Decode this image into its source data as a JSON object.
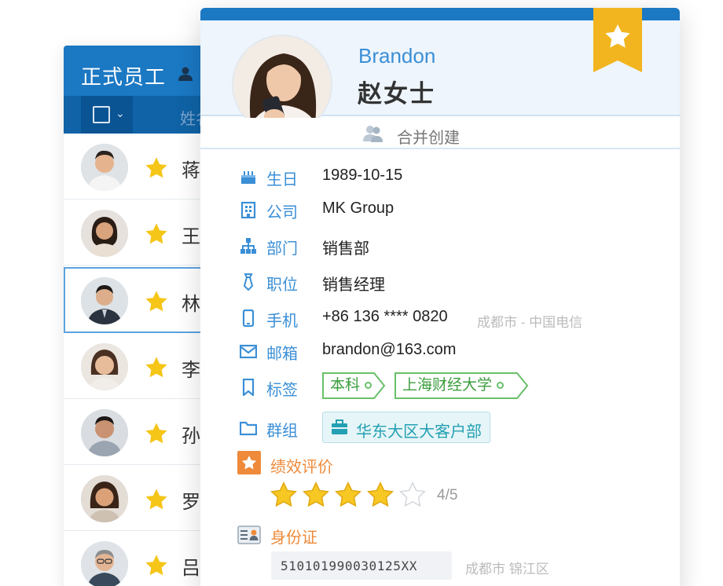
{
  "list": {
    "title": "正式员工",
    "column_name": "姓名",
    "rows": [
      {
        "name": "蒋",
        "starred": true,
        "selected": false
      },
      {
        "name": "王",
        "starred": true,
        "selected": false
      },
      {
        "name": "林",
        "starred": true,
        "selected": true
      },
      {
        "name": "李",
        "starred": true,
        "selected": false
      },
      {
        "name": "孙",
        "starred": true,
        "selected": false
      },
      {
        "name": "罗",
        "starred": true,
        "selected": false
      },
      {
        "name": "吕",
        "starred": true,
        "selected": false
      }
    ]
  },
  "card": {
    "english_name": "Brandon",
    "chinese_name": "赵女士",
    "merge_label": "合并创建",
    "fields": {
      "birthday": {
        "label": "生日",
        "value": "1989-10-15"
      },
      "company": {
        "label": "公司",
        "value": "MK Group"
      },
      "department": {
        "label": "部门",
        "value": "销售部"
      },
      "position": {
        "label": "职位",
        "value": "销售经理"
      },
      "phone": {
        "label": "手机",
        "value": "+86 136 **** 0820",
        "note": "成都市 - 中国电信"
      },
      "email": {
        "label": "邮箱",
        "value": "brandon@163.com"
      },
      "tags": {
        "label": "标签",
        "items": [
          "本科",
          "上海财经大学"
        ]
      },
      "group": {
        "label": "群组",
        "value": "华东大区大客户部"
      }
    },
    "performance": {
      "label": "绩效评价",
      "rating": 4,
      "max": 5,
      "text": "4/5"
    },
    "id_card": {
      "label": "身份证",
      "number": "510101990030125XX",
      "region": "成都市 锦江区"
    }
  },
  "colors": {
    "primary": "#1b78c3",
    "link": "#3b8fd6",
    "star": "#f5c518",
    "tag": "#69c06a",
    "group": "#23a0b3",
    "accent": "#ee8a3a"
  }
}
